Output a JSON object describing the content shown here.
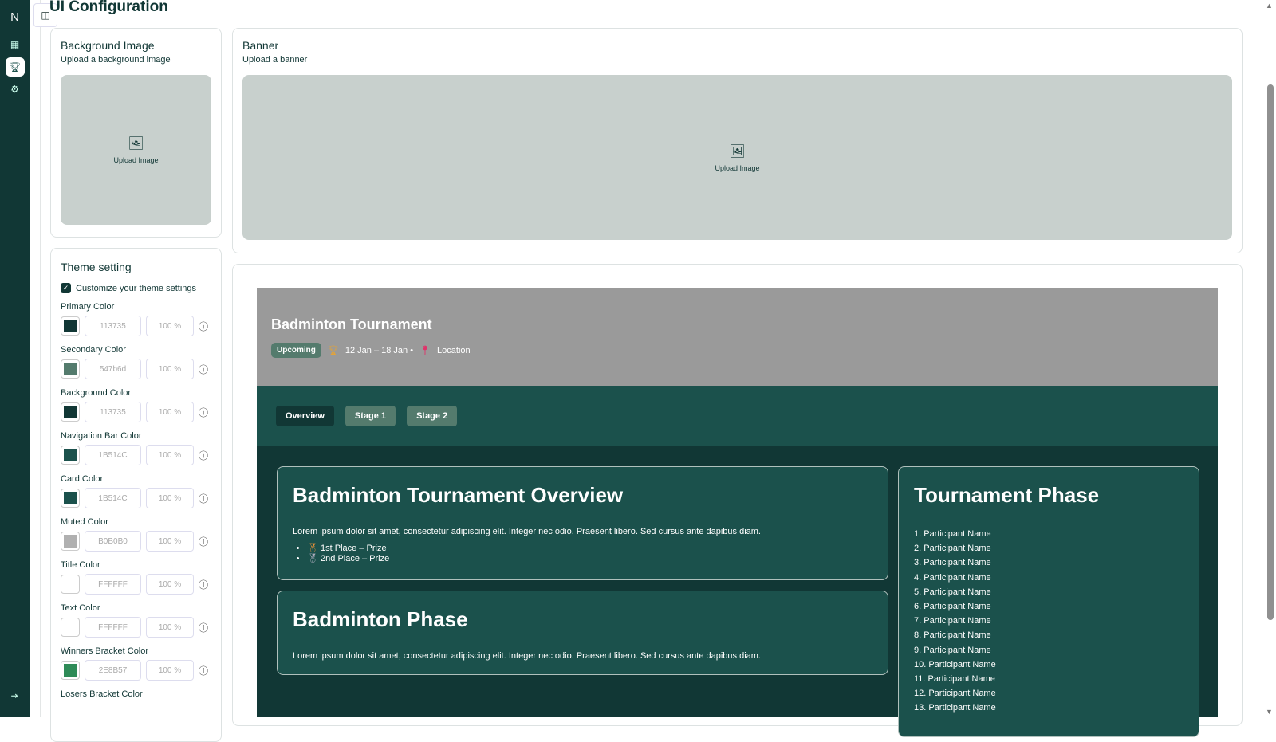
{
  "sidebar": {
    "logo": "N",
    "items": [
      "dashboard",
      "tournaments",
      "settings"
    ]
  },
  "page": {
    "title": "UI Configuration"
  },
  "background_image": {
    "title": "Background Image",
    "subtitle": "Upload a background image",
    "upload_label": "Upload Image"
  },
  "banner": {
    "title": "Banner",
    "subtitle": "Upload a banner",
    "upload_label": "Upload Image"
  },
  "theme": {
    "title": "Theme setting",
    "customize_label": "Customize your theme settings",
    "customize_checked": true,
    "colors": [
      {
        "label": "Primary Color",
        "hex": "113735",
        "opacity": "100 %",
        "swatch": "#113735"
      },
      {
        "label": "Secondary Color",
        "hex": "547b6d",
        "opacity": "100 %",
        "swatch": "#547b6d"
      },
      {
        "label": "Background Color",
        "hex": "113735",
        "opacity": "100 %",
        "swatch": "#113735"
      },
      {
        "label": "Navigation Bar Color",
        "hex": "1B514C",
        "opacity": "100 %",
        "swatch": "#1B514C"
      },
      {
        "label": "Card Color",
        "hex": "1B514C",
        "opacity": "100 %",
        "swatch": "#1B514C"
      },
      {
        "label": "Muted Color",
        "hex": "B0B0B0",
        "opacity": "100 %",
        "swatch": "#B0B0B0"
      },
      {
        "label": "Title Color",
        "hex": "FFFFFF",
        "opacity": "100 %",
        "swatch": "#FFFFFF"
      },
      {
        "label": "Text Color",
        "hex": "FFFFFF",
        "opacity": "100 %",
        "swatch": "#FFFFFF"
      },
      {
        "label": "Winners Bracket Color",
        "hex": "2E8B57",
        "opacity": "100 %",
        "swatch": "#2E8B57"
      },
      {
        "label": "Losers Bracket Color"
      }
    ]
  },
  "preview": {
    "title": "Badminton Tournament",
    "status": "Upcoming",
    "dates": "12 Jan – 18 Jan •",
    "location": "Location",
    "tabs": [
      "Overview",
      "Stage 1",
      "Stage 2"
    ],
    "overview": {
      "title": "Badminton Tournament Overview",
      "text": "Lorem ipsum dolor sit amet, consectetur adipiscing elit. Integer nec odio. Praesent libero. Sed cursus ante dapibus diam.",
      "prizes": [
        "1st Place – Prize",
        "2nd Place – Prize"
      ]
    },
    "phase": {
      "title": "Badminton Phase",
      "text": "Lorem ipsum dolor sit amet, consectetur adipiscing elit. Integer nec odio. Praesent libero. Sed cursus ante dapibus diam."
    },
    "tournament_phase": {
      "title": "Tournament Phase",
      "participants": [
        "1. Participant Name",
        "2. Participant Name",
        "3. Participant Name",
        "4. Participant Name",
        "5. Participant Name",
        "6. Participant Name",
        "7. Participant Name",
        "8. Participant Name",
        "9. Participant Name",
        "10. Participant Name",
        "11. Participant Name",
        "12. Participant Name",
        "13. Participant Name"
      ]
    }
  }
}
